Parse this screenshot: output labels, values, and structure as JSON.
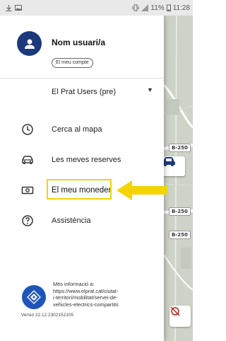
{
  "status_bar": {
    "battery": "11%",
    "time": "11:28"
  },
  "drawer": {
    "user": {
      "name": "Nom usuari/a",
      "account_chip": "El meu compte"
    },
    "organization": {
      "selected": "El Prat Users (pre)"
    },
    "menu": [
      {
        "label": "Cerca al mapa",
        "icon": "clock-icon"
      },
      {
        "label": "Les meves reserves",
        "icon": "car-icon"
      },
      {
        "label": "El meu moneder",
        "icon": "wallet-icon"
      },
      {
        "label": "Assistència",
        "icon": "help-icon"
      }
    ],
    "footer": {
      "info_lines": [
        "Més informació a:",
        "https://www.elprat.cat/ciutat-",
        "i-territori/mobilitat/servei-de-",
        "vehicles-electrics-compartits"
      ],
      "version": "Versió 22.12.2302152105"
    }
  },
  "map": {
    "road_labels": [
      "B-250",
      "B-250",
      "B-250"
    ]
  },
  "colors": {
    "brand_navy": "#1c3a7a",
    "logo_blue": "#1f55b8",
    "highlight_yellow": "#f4d400"
  }
}
